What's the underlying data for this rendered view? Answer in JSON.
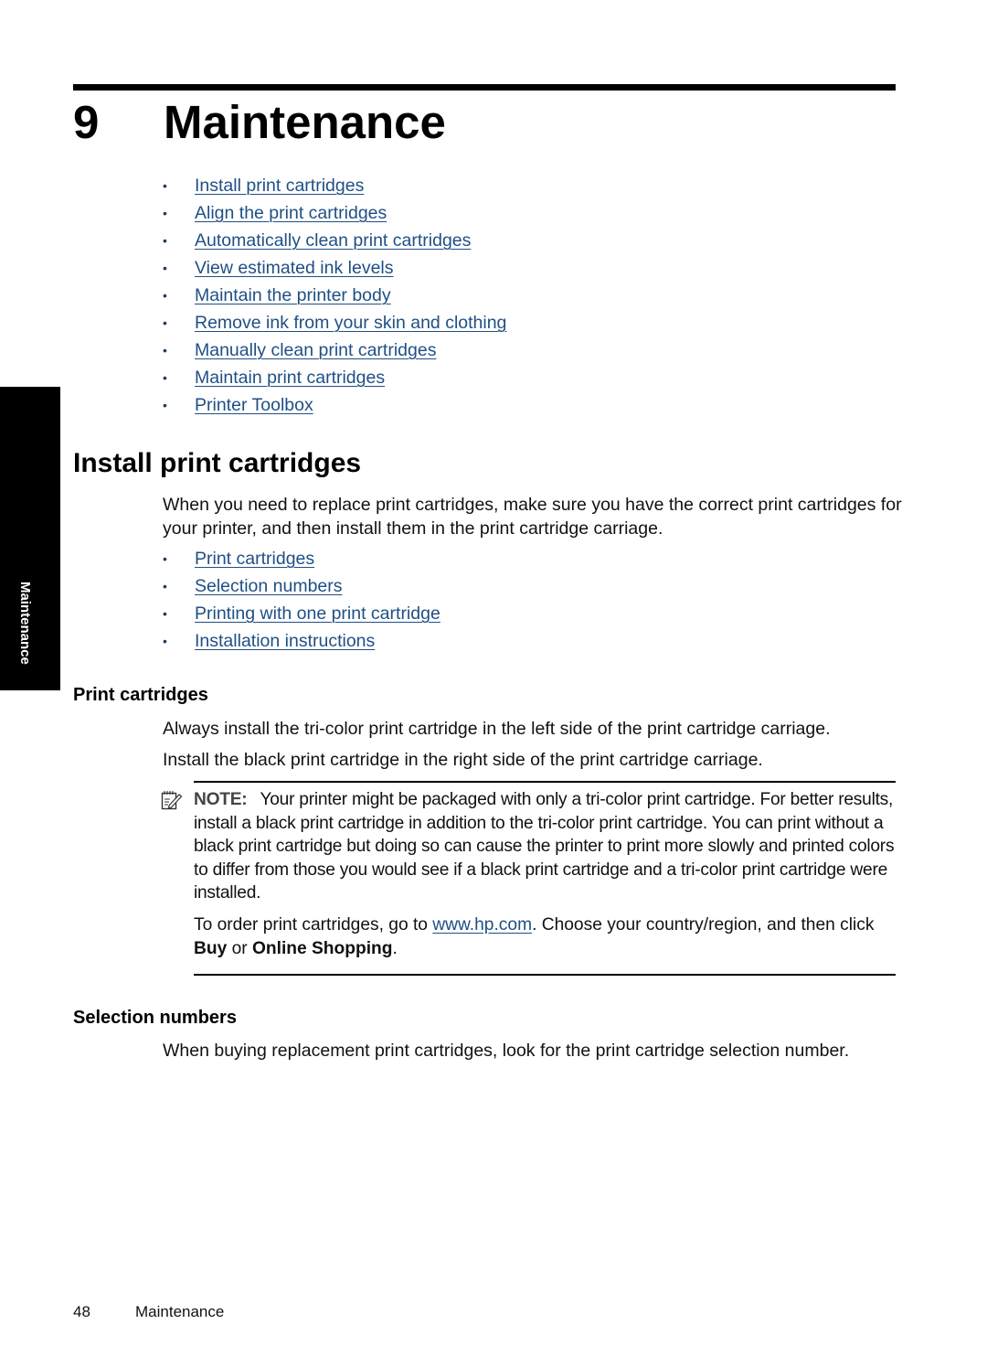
{
  "chapter": {
    "number": "9",
    "title": "Maintenance"
  },
  "side_tab": {
    "label": "Maintenance"
  },
  "toc": {
    "items": [
      {
        "label": "Install print cartridges"
      },
      {
        "label": "Align the print cartridges"
      },
      {
        "label": "Automatically clean print cartridges"
      },
      {
        "label": "View estimated ink levels"
      },
      {
        "label": "Maintain the printer body"
      },
      {
        "label": "Remove ink from your skin and clothing"
      },
      {
        "label": "Manually clean print cartridges"
      },
      {
        "label": "Maintain print cartridges"
      },
      {
        "label": "Printer Toolbox"
      }
    ]
  },
  "install_section": {
    "heading": "Install print cartridges",
    "intro": "When you need to replace print cartridges, make sure you have the correct print cartridges for your printer, and then install them in the print cartridge carriage.",
    "subtoc": [
      {
        "label": "Print cartridges"
      },
      {
        "label": "Selection numbers"
      },
      {
        "label": "Printing with one print cartridge"
      },
      {
        "label": "Installation instructions"
      }
    ]
  },
  "print_cartridges": {
    "heading": "Print cartridges",
    "para1": "Always install the tri-color print cartridge in the left side of the print cartridge carriage.",
    "para2": "Install the black print cartridge in the right side of the print cartridge carriage.",
    "note": {
      "label": "NOTE:",
      "text": "Your printer might be packaged with only a tri-color print cartridge. For better results, install a black print cartridge in addition to the tri-color print cartridge. You can print without a black print cartridge but doing so can cause the printer to print more slowly and printed colors to differ from those you would see if a black print cartridge and a tri-color print cartridge were installed.",
      "order_prefix": "To order print cartridges, go to ",
      "order_link": "www.hp.com",
      "order_middle": ". Choose your country/region, and then click ",
      "buy": "Buy",
      "or": " or ",
      "online_shopping": "Online Shopping",
      "end": "."
    }
  },
  "selection_numbers": {
    "heading": "Selection numbers",
    "text": "When buying replacement print cartridges, look for the print cartridge selection number."
  },
  "footer": {
    "page_number": "48",
    "chapter_name": "Maintenance"
  },
  "colors": {
    "link": "#1f4f84",
    "text": "#111111",
    "tab_bg": "#000000"
  }
}
